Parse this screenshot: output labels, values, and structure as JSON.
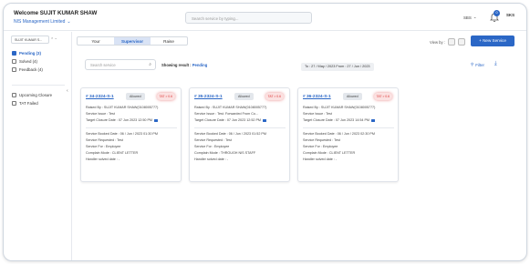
{
  "header": {
    "welcome": "Welcome SUJIT KUMAR SHAW",
    "company": "NIS Management Limited",
    "search_placeholder": "Search service by typing...",
    "language": "SBS",
    "notification_count": "0",
    "avatar": "SKS"
  },
  "sidebar": {
    "select_label": "SUJIT KUMAR S...",
    "items": [
      {
        "label": "Pending (3)",
        "checked": true
      },
      {
        "label": "Solved (4)",
        "checked": false
      },
      {
        "label": "Feedback (4)",
        "checked": false
      },
      {
        "label": "Upcoming Closure",
        "checked": false
      },
      {
        "label": "TAT Failed",
        "checked": false
      }
    ]
  },
  "toolbar": {
    "tabs": [
      "Your",
      "Supervisor",
      "Raise"
    ],
    "active_tab": "Supervisor",
    "view_by_label": "View by :",
    "new_service": "+ New Service"
  },
  "filters": {
    "search_placeholder": "Search service",
    "showing_label": "Showing result :",
    "showing_value": "Pending",
    "date_range": "To : 27 / May / 2023  From : 27 / Jun / 2023",
    "filter_label": "Filter"
  },
  "cards": [
    {
      "number": "# 34-2324-S-1",
      "status": "Allowed",
      "tat": "TAT > 0.6",
      "raised_by": "Raised By : SUJIT KUMAR SHAW(0108005777)",
      "service_issue": "Service Issue : Test",
      "target_closure": "Target Closure Date : 07 Jun 2023 12:50 PM",
      "booked": "Service Booked Date : 06 / Jun / 2023 01:30 PM",
      "requested": "Service Requested : Test",
      "service_for": "Service For : Employee",
      "complain_mode": "Complain Mode : CLIENT LETTER",
      "handler": "Handler solved date : -"
    },
    {
      "number": "# 35-2324-S-1",
      "status": "Allowed",
      "tat": "TAT > 0.6",
      "raised_by": "Raised By : SUJIT KUMAR SHAW(0108005777)",
      "service_issue": "Service Issue : Test. Forwarded From Co...",
      "target_closure": "Target Closure Date : 07 Jun 2023 12:52 PM",
      "booked": "Service Booked Date : 06 / Jun / 2023 01:52 PM",
      "requested": "Service Requested : Test",
      "service_for": "Service For : Employee",
      "complain_mode": "Complain Mode : THROUGH NIS STAFF",
      "handler": "Handler solved date : -"
    },
    {
      "number": "# 36-2324-S-1",
      "status": "Allowed",
      "tat": "TAT > 0.6",
      "raised_by": "Raised By : SUJIT KUMAR SHAW(0108005777)",
      "service_issue": "Service Issue : Test",
      "target_closure": "Target Closure Date : 07 Jun 2023 14:54 PM",
      "booked": "Service Booked Date : 06 / Jun / 2023 02:30 PM",
      "requested": "Service Requested : Test",
      "service_for": "Service For : Employee",
      "complain_mode": "Complain Mode : CLIENT LETTER",
      "handler": "Handler solved date : -"
    }
  ],
  "colors": {
    "accent": "#2b67c6",
    "tat": "#d33333"
  }
}
